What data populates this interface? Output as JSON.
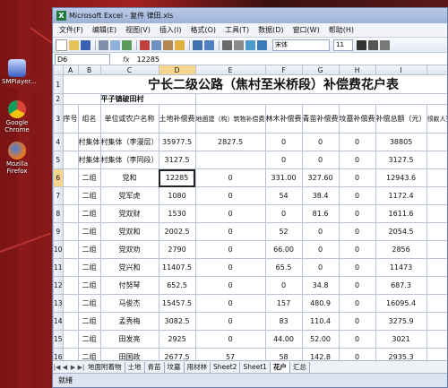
{
  "desktop": {
    "icons": [
      {
        "label": "SMPlayer..."
      },
      {
        "label": "Google Chrome"
      },
      {
        "label": "Mozilla Firefox"
      }
    ]
  },
  "window": {
    "title": "Microsoft Excel - 复件 律田.xls"
  },
  "menubar": {
    "items": [
      "文件(F)",
      "编辑(E)",
      "视图(V)",
      "插入(I)",
      "格式(O)",
      "工具(T)",
      "数据(D)",
      "窗口(W)",
      "帮助(H)"
    ]
  },
  "toolbar": {
    "font_name": "宋体",
    "font_size": "11"
  },
  "formula": {
    "name_box": "D6",
    "fx": "fx",
    "value": "12285"
  },
  "columns": [
    "A",
    "B",
    "C",
    "D",
    "E",
    "F",
    "G",
    "H",
    "I",
    "J"
  ],
  "sheet": {
    "title": "宁长二级公路（焦村至米桥段）补偿费花户表",
    "subtitle": "平子镇破田村",
    "headers": [
      "序号",
      "组名",
      "单位或农户名称",
      "土地补偿费",
      "地面建（构）筑物补偿费",
      "林木补偿费",
      "青苗补偿费",
      "坟墓补偿费",
      "补偿总额（元）",
      "领款人签名（盖章）"
    ],
    "rows": [
      {
        "num": "4",
        "cells": [
          "",
          "村集体",
          "村集体（李漫层）",
          "35977.5",
          "2827.5",
          "0",
          "0",
          "0",
          "38805",
          ""
        ]
      },
      {
        "num": "5",
        "cells": [
          "",
          "村集体",
          "村集体（李同段）",
          "3127.5",
          "",
          "0",
          "0",
          "0",
          "3127.5",
          ""
        ]
      },
      {
        "num": "6",
        "cells": [
          "",
          "二组",
          "党和",
          "12285",
          "0",
          "331.00",
          "327.60",
          "0",
          "12943.6",
          ""
        ]
      },
      {
        "num": "7",
        "cells": [
          "",
          "二组",
          "党军虎",
          "1080",
          "0",
          "54",
          "38.4",
          "0",
          "1172.4",
          ""
        ]
      },
      {
        "num": "8",
        "cells": [
          "",
          "二组",
          "党双财",
          "1530",
          "0",
          "0",
          "81.6",
          "0",
          "1611.6",
          ""
        ]
      },
      {
        "num": "9",
        "cells": [
          "",
          "二组",
          "党双和",
          "2002.5",
          "0",
          "52",
          "0",
          "0",
          "2054.5",
          ""
        ]
      },
      {
        "num": "10",
        "cells": [
          "",
          "二组",
          "党双劝",
          "2790",
          "0",
          "66.00",
          "0",
          "0",
          "2856",
          ""
        ]
      },
      {
        "num": "11",
        "cells": [
          "",
          "二组",
          "党兴和",
          "11407.5",
          "0",
          "65.5",
          "0",
          "0",
          "11473",
          ""
        ]
      },
      {
        "num": "12",
        "cells": [
          "",
          "二组",
          "付努琴",
          "652.5",
          "0",
          "0",
          "34.8",
          "0",
          "687.3",
          ""
        ]
      },
      {
        "num": "13",
        "cells": [
          "",
          "二组",
          "马俊杰",
          "15457.5",
          "0",
          "157",
          "480.9",
          "0",
          "16095.4",
          ""
        ]
      },
      {
        "num": "14",
        "cells": [
          "",
          "二组",
          "孟秀梅",
          "3082.5",
          "0",
          "83",
          "110.4",
          "0",
          "3275.9",
          ""
        ]
      },
      {
        "num": "15",
        "cells": [
          "",
          "二组",
          "田发亮",
          "2925",
          "0",
          "44.00",
          "52.00",
          "0",
          "3021",
          ""
        ]
      },
      {
        "num": "16",
        "cells": [
          "",
          "二组",
          "田国政",
          "2677.5",
          "57",
          "58",
          "142.8",
          "0",
          "2935.3",
          ""
        ]
      }
    ]
  },
  "tabs": [
    "地面附着物",
    "土地",
    "青苗",
    "坟墓",
    "用材林",
    "Sheet2",
    "Sheet1",
    "花户",
    "汇总"
  ],
  "active_tab": "花户",
  "status": "就绪"
}
